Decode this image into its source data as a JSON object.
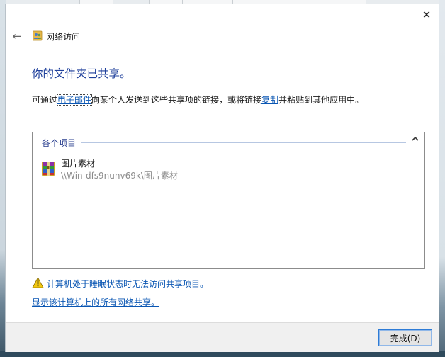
{
  "window": {
    "title": "网络访问",
    "close_glyph": "✕",
    "back_glyph": "←"
  },
  "main": {
    "heading": "你的文件夹已共享。",
    "desc_prefix": "可通过",
    "email_link": "电子邮件",
    "desc_middle": "向某个人发送到这些共享项的链接，或将链接",
    "copy_link": "复制",
    "desc_suffix": "并粘贴到其他应用中。"
  },
  "items": {
    "header": "各个项目",
    "collapse_glyph": "⌃",
    "entries": [
      {
        "name": "图片素材",
        "path": "\\\\Win-dfs9nunv69k\\图片素材",
        "icon": "winrar-archive-icon"
      }
    ]
  },
  "footer": {
    "warning_link": "计算机处于睡眠状态时无法访问共享项目。",
    "show_all_link": "显示该计算机上的所有网络共享。",
    "done_button": "完成(D)"
  },
  "colors": {
    "heading": "#1e3f9b",
    "link": "#0a56b3",
    "button_border": "#2d7bd6"
  }
}
